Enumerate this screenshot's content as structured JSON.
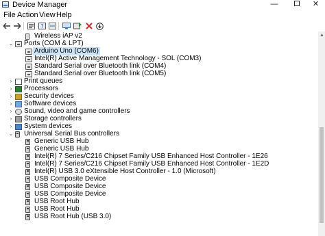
{
  "window": {
    "title": "Device Manager",
    "minimize": "—",
    "close": "✕"
  },
  "menu": [
    "File",
    "Action",
    "View",
    "Help"
  ],
  "toolbar": {
    "back_icon": "arrow-left-icon",
    "forward_icon": "arrow-right-icon",
    "properties_icon": "properties-icon",
    "help_icon": "help-icon",
    "refresh_icon": "scan-icon",
    "monitor_icon": "monitor-icon",
    "update_driver_icon": "update-driver-icon",
    "uninstall_icon": "uninstall-icon",
    "download_icon": "download-icon",
    "accent_green": "#2e8b2e",
    "accent_red": "#c62828"
  },
  "tree": {
    "rows": [
      {
        "indent": 2,
        "expander": "",
        "icon": "wifi",
        "label": "Wireless iAP v2",
        "selected": false
      },
      {
        "indent": 1,
        "expander": "⌄",
        "icon": "port",
        "label": "Ports (COM & LPT)",
        "selected": false
      },
      {
        "indent": 2,
        "expander": "",
        "icon": "port",
        "label": "Arduino Uno (COM6)",
        "selected": true
      },
      {
        "indent": 2,
        "expander": "",
        "icon": "port",
        "label": "Intel(R) Active Management Technology - SOL (COM3)",
        "selected": false
      },
      {
        "indent": 2,
        "expander": "",
        "icon": "port",
        "label": "Standard Serial over Bluetooth link (COM4)",
        "selected": false
      },
      {
        "indent": 2,
        "expander": "",
        "icon": "port",
        "label": "Standard Serial over Bluetooth link (COM5)",
        "selected": false
      },
      {
        "indent": 1,
        "expander": "›",
        "icon": "printq",
        "label": "Print queues",
        "selected": false
      },
      {
        "indent": 1,
        "expander": "›",
        "icon": "proc",
        "label": "Processors",
        "selected": false
      },
      {
        "indent": 1,
        "expander": "›",
        "icon": "sec",
        "label": "Security devices",
        "selected": false
      },
      {
        "indent": 1,
        "expander": "›",
        "icon": "soft",
        "label": "Software devices",
        "selected": false
      },
      {
        "indent": 1,
        "expander": "›",
        "icon": "sound",
        "label": "Sound, video and game controllers",
        "selected": false
      },
      {
        "indent": 1,
        "expander": "›",
        "icon": "stor",
        "label": "Storage controllers",
        "selected": false
      },
      {
        "indent": 1,
        "expander": "›",
        "icon": "sys",
        "label": "System devices",
        "selected": false
      },
      {
        "indent": 1,
        "expander": "⌄",
        "icon": "usb",
        "label": "Universal Serial Bus controllers",
        "selected": false
      },
      {
        "indent": 2,
        "expander": "",
        "icon": "usb",
        "label": "Generic USB Hub",
        "selected": false
      },
      {
        "indent": 2,
        "expander": "",
        "icon": "usb",
        "label": "Generic USB Hub",
        "selected": false
      },
      {
        "indent": 2,
        "expander": "",
        "icon": "usb",
        "label": "Intel(R) 7 Series/C216 Chipset Family USB Enhanced Host Controller - 1E26",
        "selected": false
      },
      {
        "indent": 2,
        "expander": "",
        "icon": "usb",
        "label": "Intel(R) 7 Series/C216 Chipset Family USB Enhanced Host Controller - 1E2D",
        "selected": false
      },
      {
        "indent": 2,
        "expander": "",
        "icon": "usb",
        "label": "Intel(R) USB 3.0 eXtensible Host Controller - 1.0 (Microsoft)",
        "selected": false
      },
      {
        "indent": 2,
        "expander": "",
        "icon": "usb",
        "label": "USB Composite Device",
        "selected": false
      },
      {
        "indent": 2,
        "expander": "",
        "icon": "usb",
        "label": "USB Composite Device",
        "selected": false
      },
      {
        "indent": 2,
        "expander": "",
        "icon": "usb",
        "label": "USB Composite Device",
        "selected": false
      },
      {
        "indent": 2,
        "expander": "",
        "icon": "usb",
        "label": "USB Root Hub",
        "selected": false
      },
      {
        "indent": 2,
        "expander": "",
        "icon": "usb",
        "label": "USB Root Hub",
        "selected": false
      },
      {
        "indent": 2,
        "expander": "",
        "icon": "usb",
        "label": "USB Root Hub (USB 3.0)",
        "selected": false
      }
    ]
  }
}
